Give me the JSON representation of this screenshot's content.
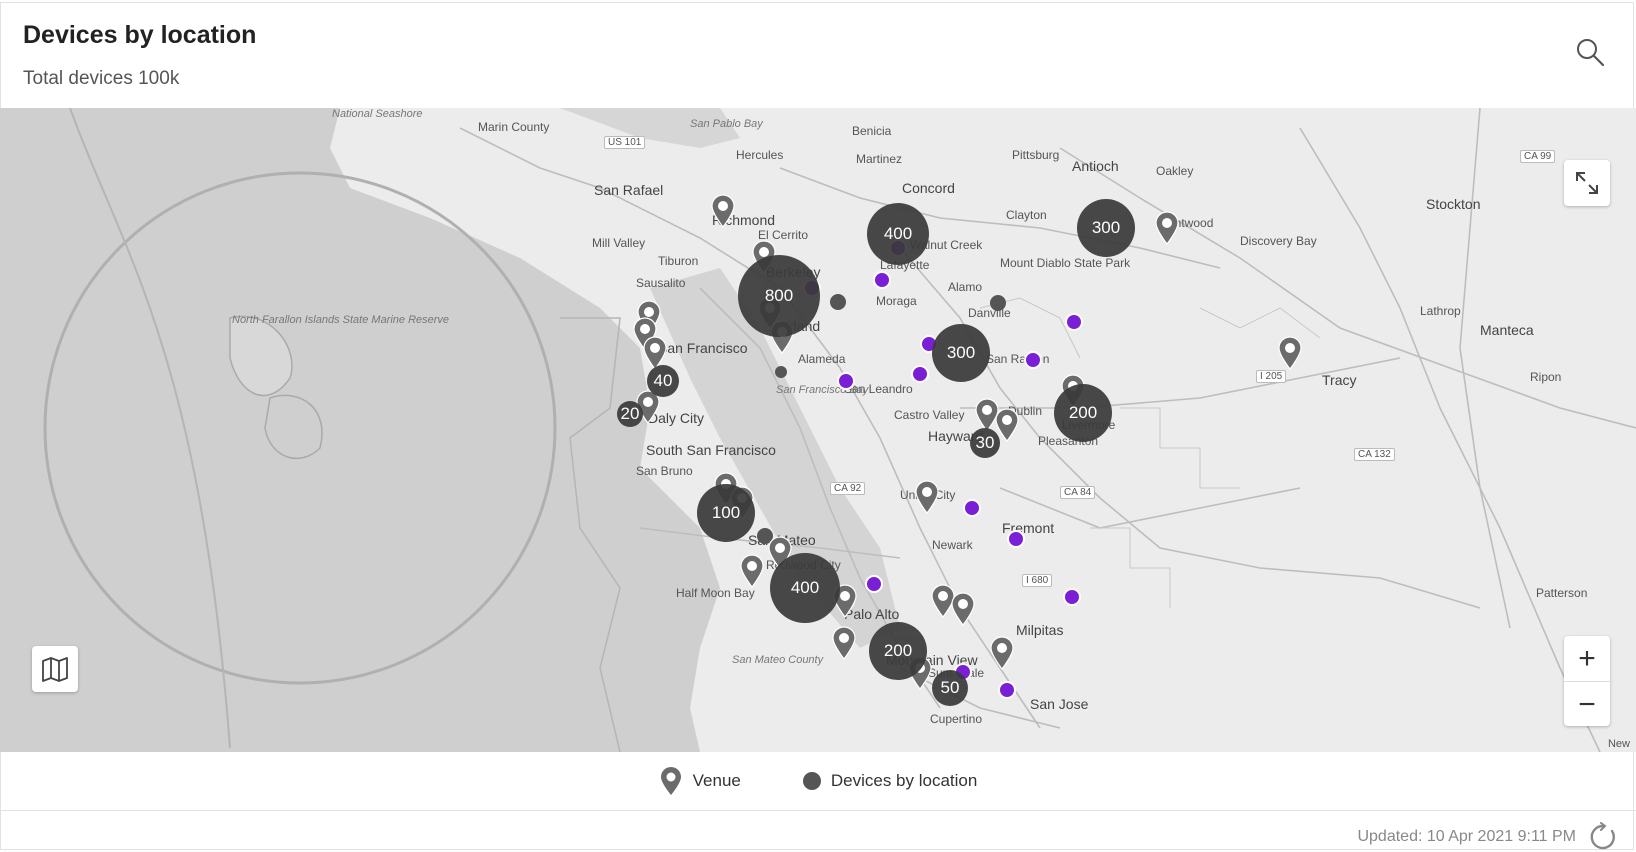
{
  "widget": {
    "title": "Devices by location",
    "subtitle": "Total devices 100k"
  },
  "map": {
    "places": [
      {
        "name": "National Seashore",
        "cls": "water"
      },
      {
        "name": "Marin County",
        "cls": ""
      },
      {
        "name": "US 101",
        "cls": "road"
      },
      {
        "name": "San Pablo Bay",
        "cls": "water"
      },
      {
        "name": "Benicia",
        "cls": ""
      },
      {
        "name": "Hercules",
        "cls": ""
      },
      {
        "name": "Martinez",
        "cls": ""
      },
      {
        "name": "Pittsburg",
        "cls": ""
      },
      {
        "name": "Antioch",
        "cls": "city"
      },
      {
        "name": "Oakley",
        "cls": ""
      },
      {
        "name": "CA 99",
        "cls": "road"
      },
      {
        "name": "San Rafael",
        "cls": "city"
      },
      {
        "name": "Concord",
        "cls": "city"
      },
      {
        "name": "Stockton",
        "cls": "city"
      },
      {
        "name": "Richmond",
        "cls": "city"
      },
      {
        "name": "El Cerrito",
        "cls": ""
      },
      {
        "name": "Clayton",
        "cls": ""
      },
      {
        "name": "Brentwood",
        "cls": ""
      },
      {
        "name": "Walnut Creek",
        "cls": ""
      },
      {
        "name": "Discovery Bay",
        "cls": ""
      },
      {
        "name": "Mill Valley",
        "cls": ""
      },
      {
        "name": "Tiburon",
        "cls": ""
      },
      {
        "name": "Berkeley",
        "cls": "city"
      },
      {
        "name": "Lafayette",
        "cls": ""
      },
      {
        "name": "Mount Diablo State Park",
        "cls": ""
      },
      {
        "name": "Sausalito",
        "cls": ""
      },
      {
        "name": "Alamo",
        "cls": ""
      },
      {
        "name": "Moraga",
        "cls": ""
      },
      {
        "name": "Oakland",
        "cls": "city"
      },
      {
        "name": "Danville",
        "cls": ""
      },
      {
        "name": "Lathrop",
        "cls": ""
      },
      {
        "name": "Manteca",
        "cls": "city"
      },
      {
        "name": "San Francisco",
        "cls": "city"
      },
      {
        "name": "Alameda",
        "cls": ""
      },
      {
        "name": "San Ramon",
        "cls": ""
      },
      {
        "name": "I 205",
        "cls": "road"
      },
      {
        "name": "Tracy",
        "cls": "city"
      },
      {
        "name": "Ripon",
        "cls": ""
      },
      {
        "name": "San Leandro",
        "cls": ""
      },
      {
        "name": "San Francisco Bay",
        "cls": "water"
      },
      {
        "name": "Castro Valley",
        "cls": ""
      },
      {
        "name": "Dublin",
        "cls": ""
      },
      {
        "name": "Daly City",
        "cls": "city"
      },
      {
        "name": "Hayward",
        "cls": "city"
      },
      {
        "name": "Livermore",
        "cls": ""
      },
      {
        "name": "Pleasanton",
        "cls": ""
      },
      {
        "name": "South San Francisco",
        "cls": "city"
      },
      {
        "name": "San Bruno",
        "cls": ""
      },
      {
        "name": "CA 132",
        "cls": "road"
      },
      {
        "name": "CA 92",
        "cls": "road"
      },
      {
        "name": "Union City",
        "cls": ""
      },
      {
        "name": "CA 84",
        "cls": "road"
      },
      {
        "name": "Fremont",
        "cls": "city"
      },
      {
        "name": "San Mateo",
        "cls": "city"
      },
      {
        "name": "Newark",
        "cls": ""
      },
      {
        "name": "Redwood City",
        "cls": ""
      },
      {
        "name": "I 680",
        "cls": "road"
      },
      {
        "name": "Half Moon Bay",
        "cls": ""
      },
      {
        "name": "Palo Alto",
        "cls": "city"
      },
      {
        "name": "Milpitas",
        "cls": "city"
      },
      {
        "name": "Patterson",
        "cls": ""
      },
      {
        "name": "Mountain View",
        "cls": "city"
      },
      {
        "name": "San Jose",
        "cls": "city"
      },
      {
        "name": "Cupertino",
        "cls": ""
      },
      {
        "name": "Sunnyvale",
        "cls": ""
      },
      {
        "name": "San Mateo County",
        "cls": "water"
      },
      {
        "name": "North Farallon Islands State Marine Reserve",
        "cls": "water"
      }
    ],
    "clusters": [
      {
        "label": "400",
        "level": 400
      },
      {
        "label": "300",
        "level": 300
      },
      {
        "label": "800",
        "level": 800
      },
      {
        "label": "300",
        "level": 300
      },
      {
        "label": "40",
        "level": 40
      },
      {
        "label": "20",
        "level": 20
      },
      {
        "label": "200",
        "level": 200
      },
      {
        "label": "30",
        "level": 30
      },
      {
        "label": "100",
        "level": 100
      },
      {
        "label": "400",
        "level": 400
      },
      {
        "label": "200",
        "level": 200
      },
      {
        "label": "50",
        "level": 50
      }
    ],
    "dots": [
      {
        "kind": "purple"
      },
      {
        "kind": "purple"
      },
      {
        "kind": "purple"
      },
      {
        "kind": "purple"
      },
      {
        "kind": "purple"
      },
      {
        "kind": "purple"
      },
      {
        "kind": "purple"
      },
      {
        "kind": "purple"
      },
      {
        "kind": "purple"
      },
      {
        "kind": "purple"
      },
      {
        "kind": "purple"
      },
      {
        "kind": "purple"
      },
      {
        "kind": "purple"
      },
      {
        "kind": "purple"
      },
      {
        "kind": "purple"
      },
      {
        "kind": "grey"
      },
      {
        "kind": "grey"
      },
      {
        "kind": "small"
      },
      {
        "kind": "grey"
      }
    ],
    "pins_count": 24,
    "attribution": "New"
  },
  "legend": {
    "venue_label": "Venue",
    "devices_label": "Devices by location"
  },
  "footer": {
    "updated": "Updated: 10 Apr 2021  9:11 PM"
  },
  "colors": {
    "cluster": "#3a3a3a",
    "purple_dot": "#7a1fd6",
    "pin": "#6b6b6b",
    "ocean": "#cfcfcf",
    "land": "#ececec"
  }
}
